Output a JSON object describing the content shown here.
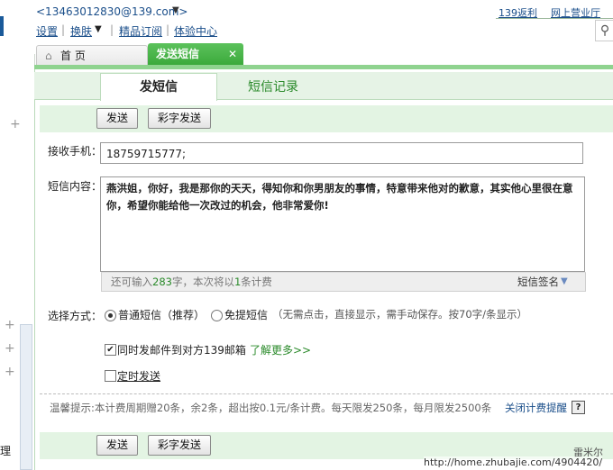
{
  "header": {
    "account": "<13463012830@139.com>",
    "nav": [
      "设置",
      "换肤",
      "精品订阅",
      "体验中心"
    ],
    "right_links": [
      "139返利",
      "网上营业厅"
    ]
  },
  "tabs": {
    "home": "首 页",
    "send": "发送短信"
  },
  "subtabs": {
    "active": "发短信",
    "other": "短信记录"
  },
  "buttons": {
    "send": "发送",
    "color_send": "彩字发送"
  },
  "form": {
    "recipient_label": "接收手机：",
    "recipient_value": "18759715777;",
    "content_label": "短信内容：",
    "content_value": "燕洪姐，你好，我是那你的天天，得知你和你男朋友的事情，特意带来他对的歉意，其实他心里很在意你，希望你能给他一次改过的机会，他非常爱你!",
    "counter_pre": "还可输入",
    "counter_remaining": "283",
    "counter_mid": "字，本次将以",
    "counter_count": "1",
    "counter_post": "条计费",
    "signature": "短信签名",
    "mode_label": "选择方式：",
    "mode_normal": "普通短信（推荐）",
    "mode_free": "免提短信",
    "mode_free_desc": "（无需点击，直接显示，需手动保存。按70字/条显示）",
    "sync_email": "同时发邮件到对方139邮箱",
    "learn_more": "了解更多>>",
    "scheduled": "定时发送"
  },
  "tip": {
    "text": "温馨提示:本计费周期赠20条，余2条，超出按0.1元/条计费。每天限发250条，每月限发2500条",
    "link": "关闭计费提醒"
  },
  "watermark": {
    "brand": "雷米尔",
    "url": "http://home.zhubajie.com/4904420/"
  },
  "left_rail": {
    "label": "理"
  },
  "icons": [
    "home-icon",
    "close-icon",
    "search-icon",
    "caret-down-icon",
    "help-icon",
    "plus-icon"
  ]
}
